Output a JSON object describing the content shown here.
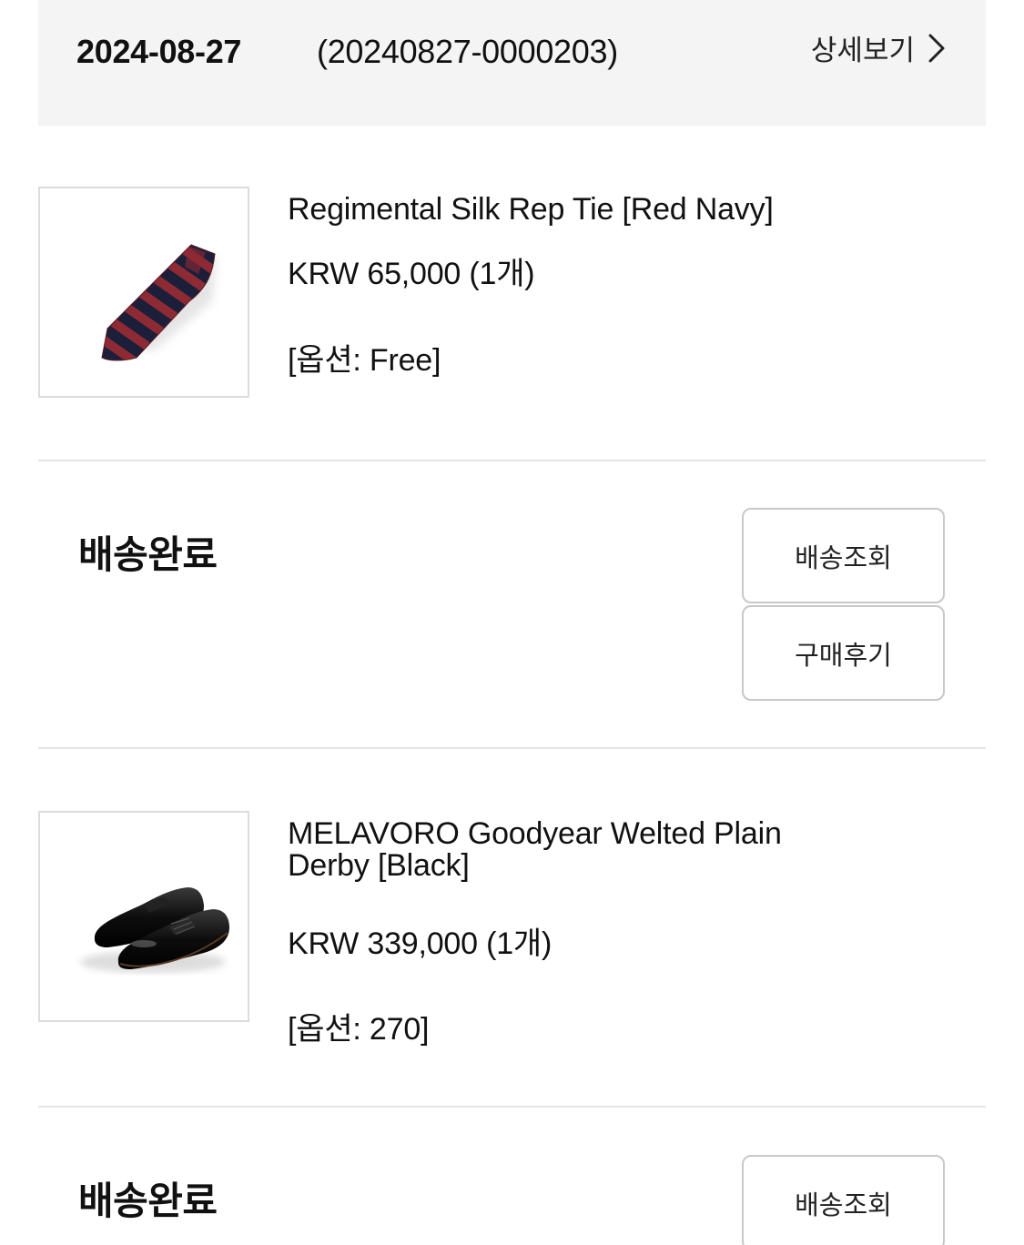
{
  "order": {
    "date": "2024-08-27",
    "number": "(20240827-0000203)",
    "detail_label": "상세보기"
  },
  "products": [
    {
      "name": "Regimental Silk Rep Tie [Red Navy]",
      "price": "KRW 65,000 (1개)",
      "option": "[옵션: Free]",
      "image_icon": "necktie-image",
      "status": "배송완료",
      "buttons": [
        "배송조회",
        "구매후기"
      ]
    },
    {
      "name_line1": "MELAVORO Goodyear Welted Plain",
      "name_line2": "Derby [Black]",
      "price": "KRW 339,000 (1개)",
      "option": "[옵션: 270]",
      "image_icon": "derby-shoes-image",
      "status": "배송완료",
      "buttons": [
        "배송조회"
      ]
    }
  ],
  "colors": {
    "header_bg": "#f4f4f4",
    "divider": "#e5e5e5",
    "button_border": "#c8c8c8",
    "tie_red": "#8e2a34",
    "tie_navy": "#1c1f3a"
  }
}
